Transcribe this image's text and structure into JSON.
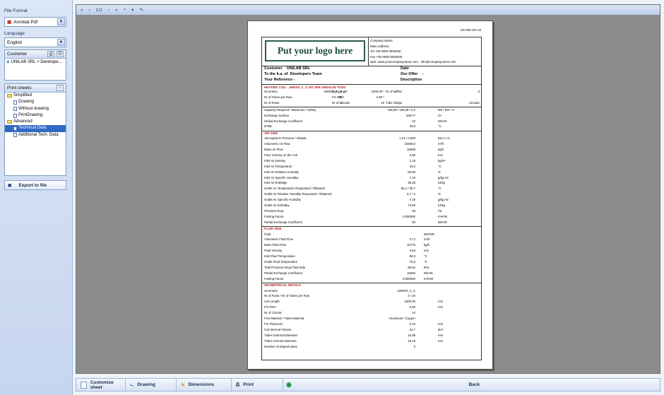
{
  "sidebar": {
    "file_format_label": "File Format",
    "file_format_value": "Acrobat Pdf",
    "language_label": "Language",
    "language_value": "English",
    "customer_label": "Customer",
    "customer_item": "UNILAB SRL > Develope...",
    "print_sheets_label": "Print sheets:",
    "tree": [
      {
        "label": "Simplified",
        "type": "folder",
        "indent": 0
      },
      {
        "label": "Drawing",
        "type": "doc",
        "indent": 1
      },
      {
        "label": "Without drawing",
        "type": "doc",
        "indent": 1
      },
      {
        "label": "PrintDrawing",
        "type": "doc",
        "indent": 1
      },
      {
        "label": "Advanced",
        "type": "folder",
        "indent": 0
      },
      {
        "label": "Technical Data",
        "type": "doc",
        "indent": 1,
        "selected": true
      },
      {
        "label": "Additional Tech. Data",
        "type": "doc",
        "indent": 1
      }
    ],
    "export_label": "Export to file"
  },
  "toolbar": {
    "page": "1/1"
  },
  "report": {
    "doc_no": "UN 900 ON 16",
    "logo": "Put your logo here",
    "company": [
      "Company Name",
      "Main Address",
      "Tel +00 0000 0000000",
      "Fax +00 0000 0000000",
      "web: www.yourcompanyname.com  -  info@companyname.com"
    ],
    "customer_label": "Customer",
    "customer_value": "UNILAB SRL",
    "date_label": "Date",
    "attn_label": "To the k.a. of",
    "attn_value": "Developers Team",
    "offer_label": "Our Offer",
    "offer_value": "-",
    "ref_label": "Your Reference -",
    "desc_label": "Description",
    "heating_title": "HEATING COIL - 1660X0_C_S 20T 4NR 1500x2.50 *D10C",
    "geom_rows": [
      [
        "Geometry",
        "1660X0_C_S",
        "Coil Length",
        "1500,00 *",
        "Nr of baffles",
        "0"
      ],
      [
        "Nr of Tubes per Row",
        "20",
        "Fin Pitch",
        "2,50 *",
        "",
        " "
      ],
      [
        "Nr of Rows",
        "4",
        "Nr of Circuits",
        "10",
        "Tube Shape",
        "Circular"
      ]
    ],
    "perf_rows": [
      [
        "Capacity Required / Maximum / Safety",
        "195,08 / 195,38 / 0,2",
        "kW / kW / %"
      ],
      [
        "Exchange Surface",
        "169,77",
        "m²"
      ],
      [
        "Global Exchange Coefficient",
        "34",
        "W/m²K"
      ],
      [
        "DTML",
        "33,8",
        "°C"
      ]
    ],
    "air_title": "AIR SIDE",
    "air_rows": [
      [
        "Atmospheric Pressure / Altitude",
        "1,01 / 0,000",
        "bar A / m"
      ],
      [
        "Volumetric Air Flow",
        "15200,0",
        "m³/h"
      ],
      [
        "Mass Air Flow",
        "18259",
        "kg/h"
      ],
      [
        "Face Velocity on the Coil",
        "2,80",
        "m/s"
      ],
      [
        "Inlet Air Density",
        "1,19",
        "kg/m³"
      ],
      [
        "Inlet Air Temperature",
        "20,0",
        "°C"
      ],
      [
        "Inlet Air Relative Humidity",
        "50,00",
        "%"
      ],
      [
        "Inlet Air Specific Humidity",
        "7,19",
        "g/kg AS"
      ],
      [
        "Inlet Air Enthalpy",
        "38,38",
        "kJ/kg"
      ],
      [
        "Outlet Air Temperature Requested / Obtained",
        "56,1 / 55,7",
        "°C"
      ],
      [
        "Outlet Air Relative Humidity Requested / Obtained",
        "0,7 / 2",
        "%"
      ],
      [
        "Outlet Air Specific Humidity",
        "7,19",
        "g/kg AS"
      ],
      [
        "Outlet Air Enthalpy",
        "74,69",
        "kJ/kg"
      ],
      [
        "Pressure Drop",
        "45",
        "Pa"
      ],
      [
        "Fouling Factor",
        "0,000000",
        "m²K/W"
      ],
      [
        "Partial Exchange Coefficient",
        "60",
        "W/m²K"
      ]
    ],
    "fluid_title": "FLUID SIDE",
    "fluid_rows": [
      [
        "Fluid",
        "",
        "WATER"
      ],
      [
        "Volumetric Fluid Flow",
        "17,2",
        "m³/h"
      ],
      [
        "Mass Fluid Flow",
        "16776",
        "kg/h"
      ],
      [
        "Fluid Velocity",
        "2,64",
        "m/s"
      ],
      [
        "Inlet Fluid Temperature",
        "80,0",
        "°C"
      ],
      [
        "Outlet Fluid Temperature",
        "70,0",
        "°C"
      ],
      [
        "Total Pressure Drop Fluid Side",
        "90,62",
        "kPa"
      ],
      [
        "Partial Exchange Coefficient",
        "18294",
        "W/m²K"
      ],
      [
        "Fouling Factor",
        "0,000000",
        "m²K/W"
      ]
    ],
    "geo_title": "GEOMETRICAL DETAILS",
    "geo_rows": [
      [
        "Geometry",
        "1660X0_C_S",
        ""
      ],
      [
        "Nr of Rows / Nr of Tubes per Row",
        "4 / 20",
        ""
      ],
      [
        "Coil Length",
        "1500,00",
        "mm"
      ],
      [
        "Fin Pitch",
        "2,50",
        "mm"
      ],
      [
        "Nr of Circuits",
        "10",
        ""
      ],
      [
        "Fins Material / Tubes Material",
        "Aluminium / Copper",
        ""
      ],
      [
        "Fin Thickness",
        "0,10",
        "mm"
      ],
      [
        "Coil Internal Volume",
        "24,7",
        "dm³"
      ],
      [
        "Tubes External Diameter",
        "15,88",
        "mm"
      ],
      [
        "Tubes Internal Diameter",
        "15,18",
        "mm"
      ],
      [
        "Number of shaped tubes",
        "0",
        ""
      ]
    ]
  },
  "bottom": {
    "customize": "Customize sheet",
    "drawing": "Drawing",
    "dimensions": "Dimensions",
    "print": "Print",
    "back": "Back"
  }
}
